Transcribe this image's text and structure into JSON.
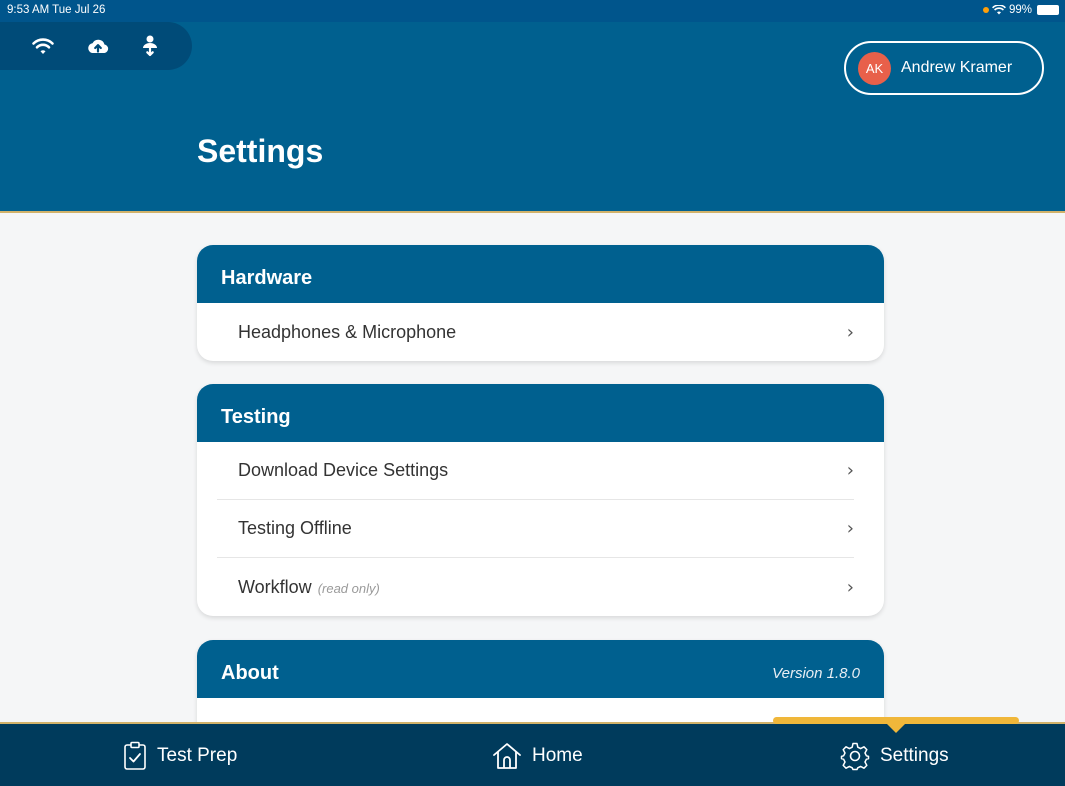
{
  "status_bar": {
    "time": "9:53 AM  Tue Jul 26",
    "battery": "99%"
  },
  "user": {
    "initials": "AK",
    "name": "Andrew Kramer"
  },
  "page": {
    "title": "Settings"
  },
  "sections": {
    "hardware": {
      "title": "Hardware",
      "items": [
        {
          "label": "Headphones & Microphone"
        }
      ]
    },
    "testing": {
      "title": "Testing",
      "items": [
        {
          "label": "Download Device Settings"
        },
        {
          "label": "Testing Offline"
        },
        {
          "label": "Workflow",
          "note": "(read only)"
        }
      ]
    },
    "about": {
      "title": "About",
      "version": "Version 1.8.0"
    }
  },
  "tab_bar": {
    "test_prep": "Test Prep",
    "home": "Home",
    "settings": "Settings"
  },
  "colors": {
    "header": "#00608f",
    "accent": "#f0b73a",
    "tab_bar": "#003b5c",
    "avatar": "#e8604a"
  }
}
